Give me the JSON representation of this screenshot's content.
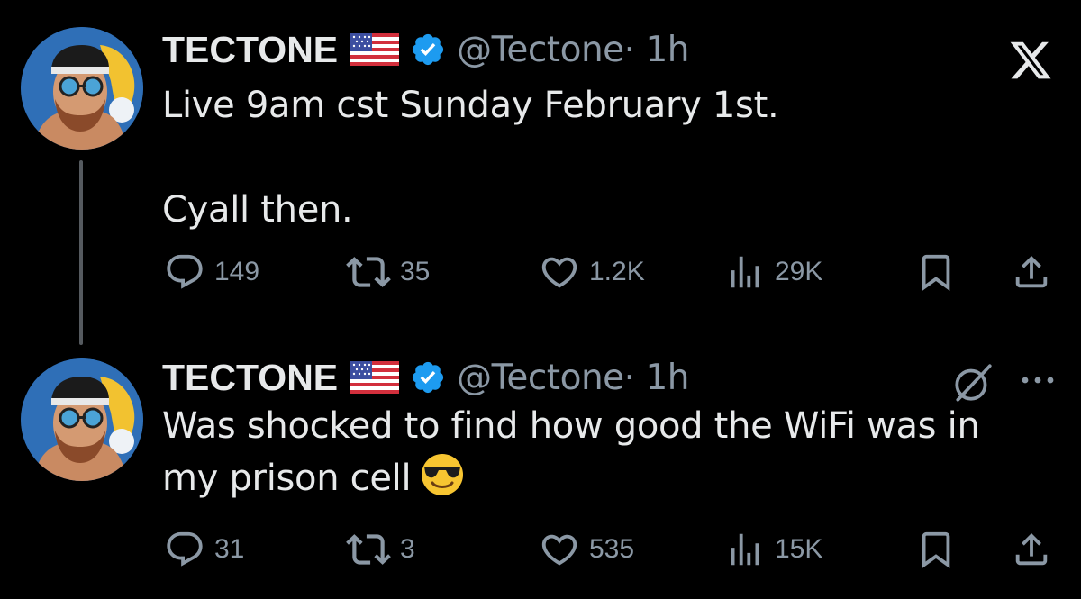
{
  "brand": {
    "logo_icon": "x-logo",
    "background": "#000000",
    "text_color": "#e7e9ea",
    "muted_color": "#8b98a5",
    "verified_color": "#1d9bf0"
  },
  "tweets": [
    {
      "author": {
        "display_name": "TECTONE",
        "flag_icon": "us-flag-emoji",
        "verified_icon": "verified-badge-icon",
        "handle": "@Tectone",
        "time": "· 1h"
      },
      "text": "Live 9am cst Sunday February 1st.\n\nCyall then.",
      "stats": {
        "replies": "149",
        "reposts": "35",
        "likes": "1.2K",
        "views": "29K"
      }
    },
    {
      "author": {
        "display_name": "TECTONE",
        "flag_icon": "us-flag-emoji",
        "verified_icon": "verified-badge-icon",
        "handle": "@Tectone",
        "time": "· 1h"
      },
      "text": "Was shocked to find how good the WiFi was in\nmy prison cell",
      "text_emoji": "smiling-face-with-sunglasses-emoji",
      "stats": {
        "replies": "31",
        "reposts": "3",
        "likes": "535",
        "views": "15K"
      }
    }
  ]
}
